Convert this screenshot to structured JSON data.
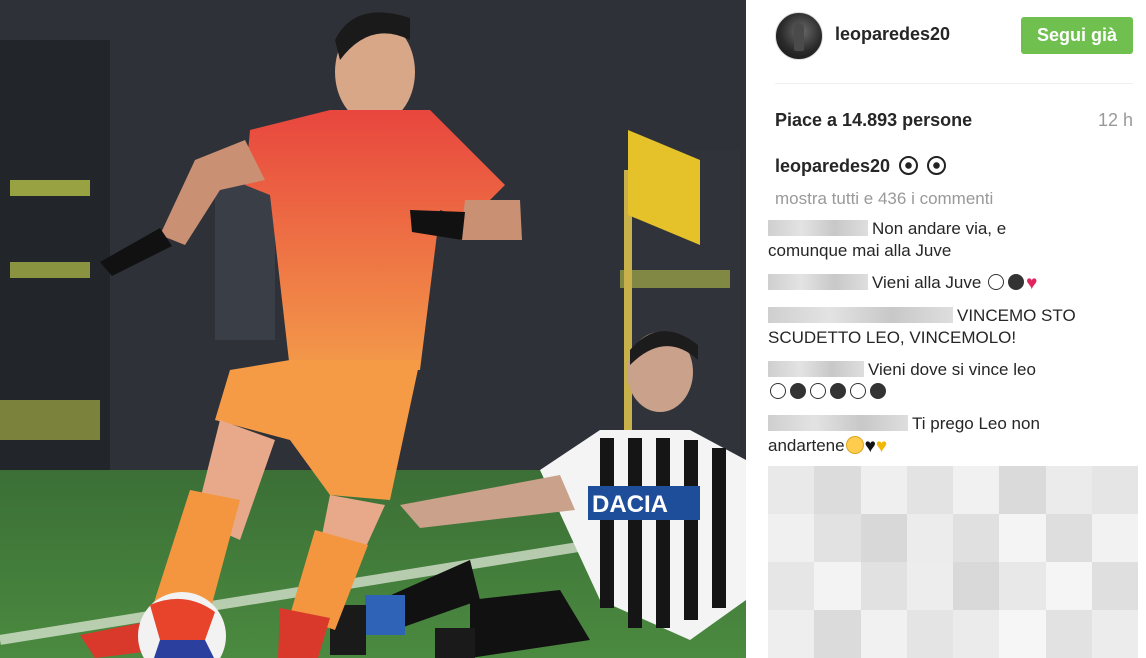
{
  "post": {
    "username": "leoparedes20",
    "follow_label": "Segui già",
    "likes_text": "Piace a 14.893 persone",
    "time_ago": "12 h",
    "caption_user": "leoparedes20",
    "caption_icons": [
      "soccer-ball-icon",
      "soccer-ball-icon"
    ],
    "show_all_comments": "mostra tutti e 436 i commenti"
  },
  "comments": [
    {
      "text_1": "Non andare via, e",
      "text_2": "comunque mai alla Juve"
    },
    {
      "text_1": "Vieni alla Juve"
    },
    {
      "text_1": "VINCEMO STO",
      "text_2": "SCUDETTO LEO, VINCEMOLO!"
    },
    {
      "text_1": "Vieni dove si vince leo"
    },
    {
      "text_1": "Ti prego Leo non",
      "text_2": "andartene"
    }
  ],
  "photo": {
    "jersey_sponsor": "DACIA"
  },
  "colors": {
    "follow_button": "#70c050",
    "muted_text": "#999999"
  }
}
